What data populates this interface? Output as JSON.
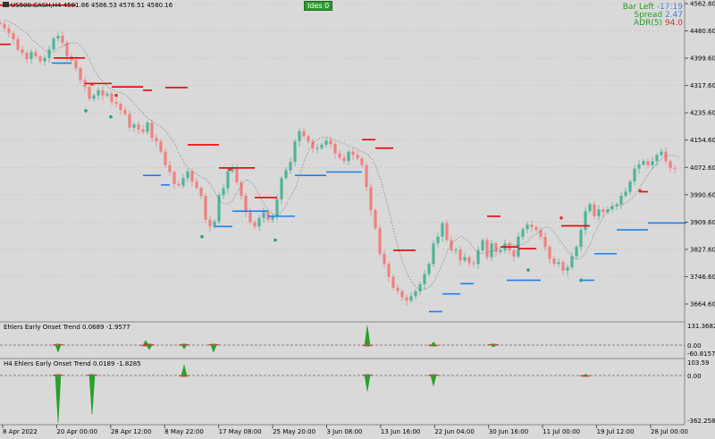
{
  "header": {
    "symbol_line": "US500.CASH,H4  4581.86 4586.53 4576.51 4580.16",
    "badge": "Ides 0",
    "info": {
      "bar_left_label": "Bar Left",
      "bar_left_value": "-17:19",
      "spread_label": "Spread",
      "spread_value": "2.47",
      "adr_label": "ADR(5)",
      "adr_value": "94.0"
    }
  },
  "colors": {
    "background": "#d9d9d9",
    "bull_candle": "#4fb39a",
    "bear_candle": "#f08080",
    "resistance": "#ee0000",
    "support": "#1e7ff0",
    "dotted": "#555555",
    "grid": "#b5b5b5",
    "osc_green": "#2aa02a",
    "osc_red": "#c0392b",
    "zero_line": "#666666"
  },
  "chart_data": [
    {
      "type": "line",
      "title": "US500.CASH,H4",
      "series_style": "candlestick with red resistance and blue support trailing stops",
      "x_tick_labels": [
        "8 Apr 2022",
        "20 Apr 00:00",
        "28 Apr 12:00",
        "8 May 22:00",
        "17 May 08:00",
        "25 May 20:00",
        "3 Jun 08:00",
        "13 Jun 16:00",
        "22 Jun 04:00",
        "30 Jun 16:00",
        "11 Jul 00:00",
        "19 Jul 12:00",
        "28 Jul 00:00"
      ],
      "y_tick_labels": [
        "4562.80",
        "4480.60",
        "4399.60",
        "4317.60",
        "4235.60",
        "4154.60",
        "4072.60",
        "3990.60",
        "3909.60",
        "3827.60",
        "3746.60",
        "3664.60"
      ],
      "ylim": [
        3635,
        4570
      ],
      "price": {
        "x": [
          0,
          5,
          10,
          15,
          20,
          25,
          30,
          35,
          40,
          45,
          50,
          55,
          60,
          65,
          70,
          75,
          80,
          85,
          90,
          95,
          100,
          105,
          110,
          115,
          120,
          125,
          130,
          135,
          140,
          145,
          150,
          155,
          160,
          165,
          170,
          175,
          180,
          185,
          190,
          195,
          200,
          205,
          210,
          215,
          220,
          225,
          230,
          235,
          240,
          245,
          250,
          255,
          260,
          265,
          270,
          275,
          280,
          285,
          290,
          295,
          300,
          305,
          310,
          315,
          320,
          325,
          330,
          335,
          340,
          345,
          350,
          355,
          360,
          365,
          370,
          375,
          380,
          385,
          390,
          395,
          400,
          405,
          410,
          415,
          420,
          425,
          430,
          435,
          440,
          445,
          450,
          455,
          460,
          465,
          470,
          475,
          480,
          485,
          490,
          495,
          500,
          505,
          510,
          515,
          520,
          525,
          530,
          535,
          540,
          545,
          550,
          555,
          560,
          565,
          570,
          575,
          580,
          585,
          590,
          595,
          600,
          605,
          610,
          615,
          620,
          625,
          630,
          635,
          640,
          645,
          650,
          655,
          660,
          665,
          670,
          675,
          680,
          685,
          690,
          695,
          700,
          705,
          710,
          715,
          720,
          725,
          730,
          735,
          740,
          745,
          750,
          755,
          760,
          765,
          768
        ],
        "y": [
          4505,
          4492,
          4478,
          4460,
          4430,
          4420,
          4402,
          4422,
          4410,
          4395,
          4405,
          4430,
          4462,
          4470,
          4450,
          4410,
          4398,
          4375,
          4340,
          4320,
          4285,
          4295,
          4310,
          4295,
          4300,
          4275,
          4270,
          4252,
          4240,
          4200,
          4210,
          4195,
          4188,
          4215,
          4170,
          4160,
          4130,
          4090,
          4070,
          4035,
          4030,
          4052,
          4072,
          4042,
          4023,
          4000,
          3930,
          3910,
          3925,
          4002,
          4022,
          4072,
          4082,
          4040,
          4000,
          3952,
          3922,
          3910,
          3935,
          3952,
          3930,
          3940,
          3990,
          4052,
          4075,
          4100,
          4160,
          4190,
          4175,
          4160,
          4140,
          4140,
          4150,
          4162,
          4152,
          4125,
          4112,
          4102,
          4130,
          4120,
          4110,
          4090,
          4025,
          3958,
          3905,
          3830,
          3800,
          3762,
          3730,
          3720,
          3702,
          3692,
          3705,
          3720,
          3740,
          3770,
          3800,
          3860,
          3880,
          3920,
          3870,
          3840,
          3842,
          3810,
          3820,
          3802,
          3800,
          3840,
          3870,
          3820,
          3860,
          3835,
          3840,
          3860,
          3840,
          3822,
          3880,
          3902,
          3915,
          3908,
          3900,
          3880,
          3850,
          3815,
          3800,
          3805,
          3780,
          3790,
          3822,
          3850,
          3900,
          3955,
          3975,
          3940,
          3960,
          3952,
          3960,
          3970,
          3975,
          4000,
          4012,
          4042,
          4080,
          4092,
          4102,
          4090,
          4102,
          4120,
          4130,
          4102,
          4082,
          4080
        ]
      },
      "resistance_segments": [
        {
          "x": [
            0,
            85
          ],
          "y": [
            4560,
            4560
          ]
        },
        {
          "x": [
            0,
            12
          ],
          "y": [
            4445,
            4445
          ]
        },
        {
          "x": [
            60,
            95
          ],
          "y": [
            4405,
            4405
          ]
        },
        {
          "x": [
            95,
            125
          ],
          "y": [
            4330,
            4330
          ]
        },
        {
          "x": [
            125,
            160
          ],
          "y": [
            4320,
            4320
          ]
        },
        {
          "x": [
            160,
            170
          ],
          "y": [
            4310,
            4310
          ]
        },
        {
          "x": [
            185,
            210
          ],
          "y": [
            4318,
            4318
          ]
        },
        {
          "x": [
            210,
            245
          ],
          "y": [
            4150,
            4150
          ]
        },
        {
          "x": [
            245,
            285
          ],
          "y": [
            4082,
            4082
          ]
        },
        {
          "x": [
            285,
            310
          ],
          "y": [
            3995,
            3995
          ]
        },
        {
          "x": [
            405,
            420
          ],
          "y": [
            4165,
            4165
          ]
        },
        {
          "x": [
            420,
            440
          ],
          "y": [
            4140,
            4140
          ]
        },
        {
          "x": [
            440,
            465
          ],
          "y": [
            3840,
            3840
          ]
        },
        {
          "x": [
            545,
            560
          ],
          "y": [
            3940,
            3940
          ]
        },
        {
          "x": [
            560,
            580
          ],
          "y": [
            3850,
            3850
          ]
        },
        {
          "x": [
            580,
            600
          ],
          "y": [
            3845,
            3845
          ]
        },
        {
          "x": [
            628,
            660
          ],
          "y": [
            3912,
            3912
          ]
        },
        {
          "x": [
            715,
            725
          ],
          "y": [
            4012,
            4012
          ]
        }
      ],
      "support_segments": [
        {
          "x": [
            58,
            80
          ],
          "y": [
            4390,
            4390
          ]
        },
        {
          "x": [
            160,
            180
          ],
          "y": [
            4060,
            4060
          ]
        },
        {
          "x": [
            180,
            190
          ],
          "y": [
            4032,
            4032
          ]
        },
        {
          "x": [
            240,
            260
          ],
          "y": [
            3910,
            3910
          ]
        },
        {
          "x": [
            260,
            300
          ],
          "y": [
            3955,
            3955
          ]
        },
        {
          "x": [
            300,
            330
          ],
          "y": [
            3940,
            3940
          ]
        },
        {
          "x": [
            330,
            365
          ],
          "y": [
            4060,
            4060
          ]
        },
        {
          "x": [
            365,
            405
          ],
          "y": [
            4070,
            4070
          ]
        },
        {
          "x": [
            480,
            495
          ],
          "y": [
            3660,
            3660
          ]
        },
        {
          "x": [
            495,
            515
          ],
          "y": [
            3712,
            3712
          ]
        },
        {
          "x": [
            515,
            530
          ],
          "y": [
            3742,
            3742
          ]
        },
        {
          "x": [
            567,
            605
          ],
          "y": [
            3752,
            3752
          ]
        },
        {
          "x": [
            650,
            665
          ],
          "y": [
            3752,
            3752
          ]
        },
        {
          "x": [
            665,
            690
          ],
          "y": [
            3830,
            3830
          ]
        },
        {
          "x": [
            690,
            725
          ],
          "y": [
            3900,
            3900
          ]
        },
        {
          "x": [
            725,
            768
          ],
          "y": [
            3920,
            3920
          ]
        }
      ],
      "markers": [
        {
          "x": 96,
          "y": 4250,
          "kind": "bull"
        },
        {
          "x": 124,
          "y": 4232,
          "kind": "bull"
        },
        {
          "x": 226,
          "y": 3880,
          "kind": "bull"
        },
        {
          "x": 308,
          "y": 3870,
          "kind": "bull"
        },
        {
          "x": 591,
          "y": 3782,
          "kind": "bull"
        },
        {
          "x": 650,
          "y": 3752,
          "kind": "bull"
        },
        {
          "x": 103,
          "y": 4328,
          "kind": "bear"
        },
        {
          "x": 130,
          "y": 4295,
          "kind": "bear"
        },
        {
          "x": 257,
          "y": 4078,
          "kind": "bear"
        },
        {
          "x": 628,
          "y": 3935,
          "kind": "bear"
        },
        {
          "x": 716,
          "y": 4015,
          "kind": "bear"
        }
      ]
    },
    {
      "type": "line",
      "title": "Ehlers Early Onset Trend 0.0689 -1.9577",
      "y_tick_labels": [
        "131.3682",
        "0.00",
        "-60.8157"
      ],
      "ylim": [
        -60.8157,
        131.3682
      ],
      "spikes": [
        {
          "x": 65,
          "value": -40
        },
        {
          "x": 163,
          "value": 30
        },
        {
          "x": 167,
          "value": -25
        },
        {
          "x": 206,
          "value": -20
        },
        {
          "x": 239,
          "value": -40
        },
        {
          "x": 411,
          "value": 131.3682
        },
        {
          "x": 485,
          "value": 20
        },
        {
          "x": 552,
          "value": -10
        }
      ]
    },
    {
      "type": "line",
      "title": "H4 Ehlers Early Onset Trend 0.0189 -1.8285",
      "y_tick_labels": [
        "103.59",
        "0.00",
        "-362.2586"
      ],
      "ylim": [
        -362.2586,
        103.59
      ],
      "spikes": [
        {
          "x": 65,
          "value": -362
        },
        {
          "x": 103,
          "value": -300
        },
        {
          "x": 206,
          "value": 80
        },
        {
          "x": 411,
          "value": -120
        },
        {
          "x": 485,
          "value": -80
        },
        {
          "x": 655,
          "value": 10
        }
      ]
    }
  ]
}
